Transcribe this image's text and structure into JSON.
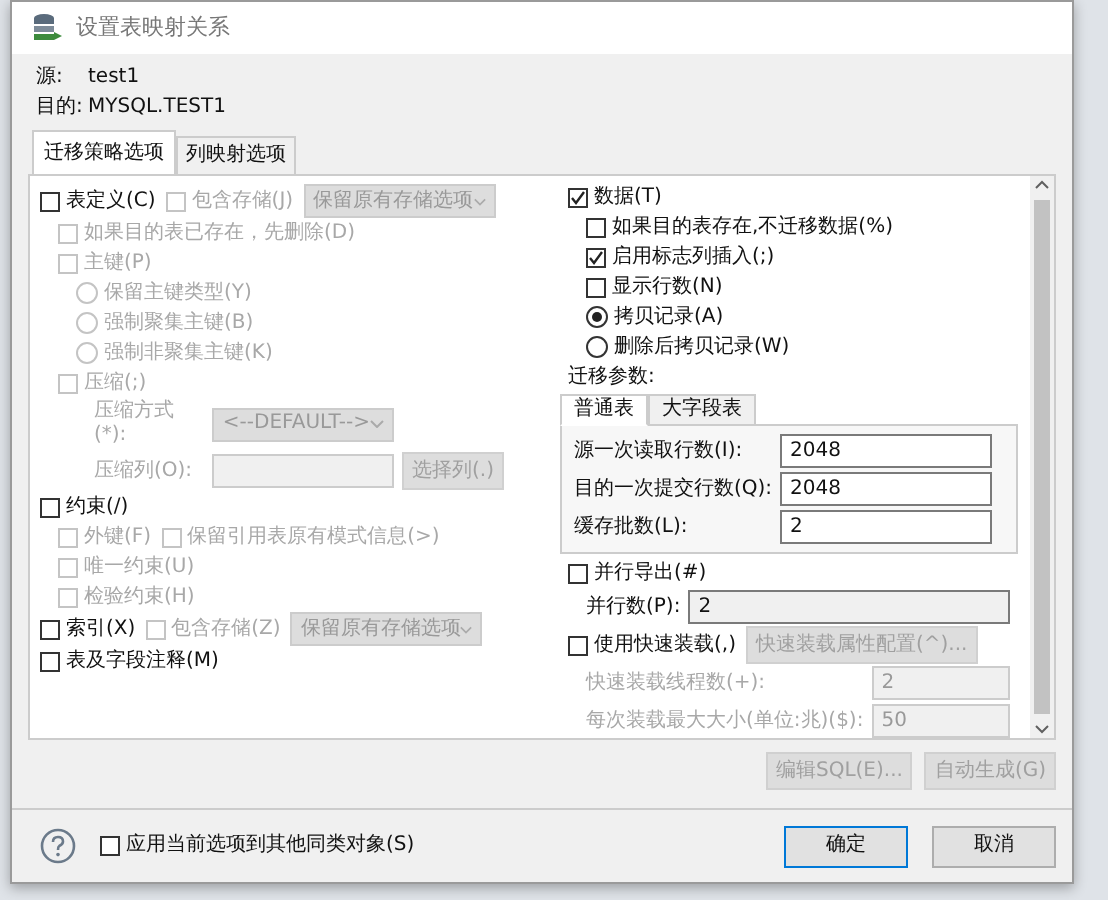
{
  "window": {
    "title": "设置表映射关系"
  },
  "info": [
    {
      "label": "源:",
      "value": "test1"
    },
    {
      "label": "目的:",
      "value": "MYSQL.TEST1"
    }
  ],
  "tabs": [
    {
      "label": "迁移策略选项",
      "selected": true
    },
    {
      "label": "列映射选项",
      "selected": false
    }
  ],
  "left": [
    {
      "kind": "checkbox",
      "label": "表定义(C)",
      "checked": false,
      "disabled": false,
      "extras": [
        {
          "kind": "checkbox",
          "label": "包含存储(J)",
          "checked": false,
          "disabled": true
        },
        {
          "kind": "select",
          "value": "保留原有存储选项",
          "disabled": true
        }
      ],
      "children": [
        {
          "kind": "checkbox",
          "label": "如果目的表已存在，先删除(D)",
          "checked": false,
          "disabled": true
        },
        {
          "kind": "checkbox",
          "label": "主键(P)",
          "checked": false,
          "disabled": true,
          "children": [
            {
              "kind": "radio",
              "label": "保留主键类型(Y)",
              "selected": false,
              "disabled": true
            },
            {
              "kind": "radio",
              "label": "强制聚集主键(B)",
              "selected": false,
              "disabled": true
            },
            {
              "kind": "radio",
              "label": "强制非聚集主键(K)",
              "selected": false,
              "disabled": true
            }
          ]
        },
        {
          "kind": "checkbox",
          "label": "压缩(;)",
          "checked": false,
          "disabled": true,
          "children": [
            {
              "kind": "select-field",
              "label": "压缩方式(*):",
              "value": "<--DEFAULT-->",
              "disabled": true
            },
            {
              "kind": "field",
              "label": "压缩列(O):",
              "disabled": true,
              "extras": [
                {
                  "kind": "button",
                  "label": "选择列(.)",
                  "disabled": true
                }
              ]
            }
          ]
        }
      ]
    },
    {
      "kind": "checkbox",
      "label": "约束(/)",
      "checked": false,
      "disabled": false,
      "children": [
        {
          "kind": "checkbox",
          "label": "外键(F)",
          "checked": false,
          "disabled": true,
          "extras": [
            {
              "kind": "checkbox",
              "label": "保留引用表原有模式信息(>)",
              "checked": false,
              "disabled": true
            }
          ]
        },
        {
          "kind": "checkbox",
          "label": "唯一约束(U)",
          "checked": false,
          "disabled": true
        },
        {
          "kind": "checkbox",
          "label": "检验约束(H)",
          "checked": false,
          "disabled": true
        }
      ]
    },
    {
      "kind": "checkbox",
      "label": "索引(X)",
      "checked": false,
      "disabled": false,
      "extras": [
        {
          "kind": "checkbox",
          "label": "包含存储(Z)",
          "checked": false,
          "disabled": true
        },
        {
          "kind": "select",
          "value": "保留原有存储选项",
          "disabled": true
        }
      ]
    },
    {
      "kind": "checkbox",
      "label": "表及字段注释(M)",
      "checked": false,
      "disabled": false
    }
  ],
  "right": [
    {
      "kind": "checkbox",
      "label": "数据(T)",
      "checked": true,
      "disabled": false,
      "children": [
        {
          "kind": "checkbox",
          "label": "如果目的表存在,不迁移数据(%)",
          "checked": false,
          "disabled": false
        },
        {
          "kind": "checkbox",
          "label": "启用标志列插入(;)",
          "checked": true,
          "disabled": false
        },
        {
          "kind": "checkbox",
          "label": "显示行数(N)",
          "checked": false,
          "disabled": false
        },
        {
          "kind": "radio",
          "label": "拷贝记录(A)",
          "selected": true,
          "disabled": false
        },
        {
          "kind": "radio",
          "label": "删除后拷贝记录(W)",
          "selected": false,
          "disabled": false
        }
      ]
    },
    {
      "kind": "text",
      "label": "迁移参数:"
    },
    {
      "kind": "tabset",
      "tabs": [
        {
          "label": "普通表",
          "selected": true
        },
        {
          "label": "大字段表",
          "selected": false
        }
      ],
      "fields": [
        {
          "kind": "field",
          "label": "源一次读取行数(I):",
          "value": "2048",
          "disabled": false
        },
        {
          "kind": "field",
          "label": "目的一次提交行数(Q):",
          "value": "2048",
          "disabled": false
        },
        {
          "kind": "field",
          "label": "缓存批数(L):",
          "value": "2",
          "disabled": false
        }
      ]
    },
    {
      "kind": "checkbox",
      "label": "并行导出(#)",
      "checked": false,
      "disabled": false,
      "children": [
        {
          "kind": "field",
          "label": "并行数(P):",
          "value": "2",
          "disabled": false,
          "readonly": true
        }
      ]
    },
    {
      "kind": "checkbox",
      "label": "使用快速装载(,)",
      "checked": false,
      "disabled": false,
      "extras": [
        {
          "kind": "button",
          "label": "快速装载属性配置(^)...",
          "disabled": true
        }
      ],
      "children": [
        {
          "kind": "field",
          "label": "快速装载线程数(+):",
          "value": "2",
          "disabled": true
        },
        {
          "kind": "field",
          "label": "每次装载最大大小(单位:兆)($):",
          "value": "50",
          "disabled": true
        }
      ]
    }
  ],
  "actions": [
    {
      "label": "编辑SQL(E)...",
      "disabled": true
    },
    {
      "label": "自动生成(G)",
      "disabled": true
    }
  ],
  "footer": {
    "option": {
      "label": "应用当前选项到其他同类对象(S)",
      "checked": false
    },
    "buttons": [
      {
        "label": "确定",
        "default": true
      },
      {
        "label": "取消",
        "default": false
      }
    ]
  }
}
